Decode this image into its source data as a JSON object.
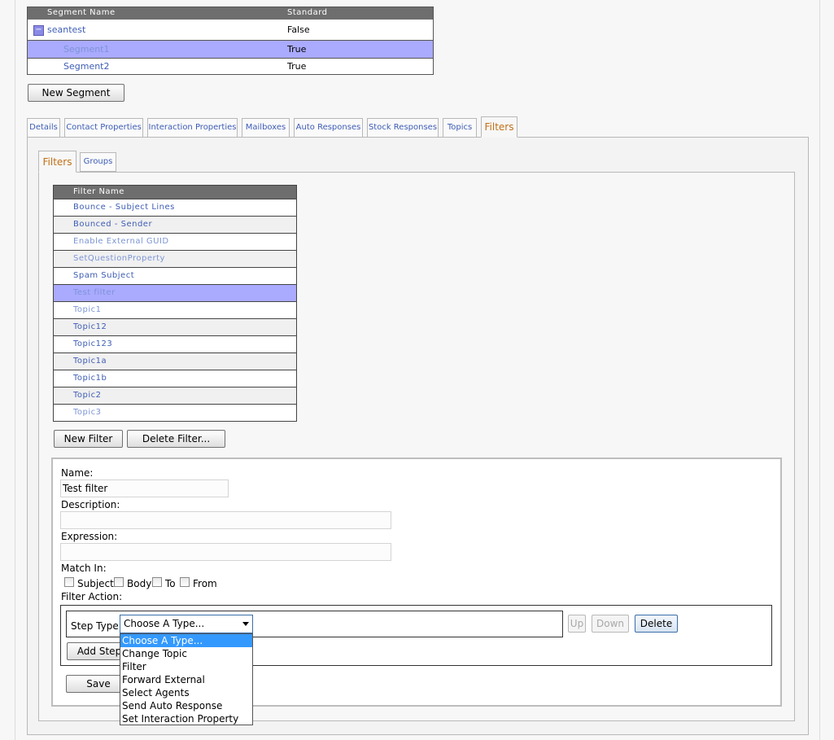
{
  "segments": {
    "columns": [
      "Segment Name",
      "Standard"
    ],
    "rows": [
      {
        "name": "seantest",
        "standard": "False",
        "expander": "collapse-icon",
        "expander_glyph": "−"
      },
      {
        "name": "Segment1",
        "standard": "True"
      },
      {
        "name": "Segment2",
        "standard": "True"
      }
    ]
  },
  "new_segment_label": "New Segment",
  "tabs": [
    "Details",
    "Contact Properties",
    "Interaction Properties",
    "Mailboxes",
    "Auto Responses",
    "Stock Responses",
    "Topics",
    "Filters"
  ],
  "active_tab": "Filters",
  "subtabs": [
    "Filters",
    "Groups"
  ],
  "active_subtab": "Filters",
  "filters": {
    "column": "Filter Name",
    "rows": [
      "Bounce - Subject Lines",
      "Bounced - Sender",
      "Enable External GUID",
      "SetQuestionProperty",
      "Spam Subject",
      "Test filter",
      "Topic1",
      "Topic12",
      "Topic123",
      "Topic1a",
      "Topic1b",
      "Topic2",
      "Topic3"
    ],
    "selected": "Test filter"
  },
  "buttons": {
    "new_filter": "New Filter",
    "delete_filter": "Delete Filter...",
    "up": "Up",
    "down": "Down",
    "delete": "Delete",
    "add_step": "Add Step",
    "save": "Save"
  },
  "form": {
    "name_label": "Name:",
    "name_value": "Test filter",
    "description_label": "Description:",
    "description_value": "",
    "expression_label": "Expression:",
    "expression_value": "",
    "match_in_label": "Match In:",
    "match_options": [
      {
        "label": "Subject",
        "checked": false
      },
      {
        "label": "Body",
        "checked": false
      },
      {
        "label": "To",
        "checked": false
      },
      {
        "label": "From",
        "checked": false
      }
    ],
    "filter_action_label": "Filter Action:",
    "step_type_label": "Step Type:",
    "step_type_value": "Choose A Type...",
    "step_type_options": [
      "Choose A Type...",
      "Change Topic",
      "Filter",
      "Forward External",
      "Select Agents",
      "Send Auto Response",
      "Set Interaction Property"
    ]
  },
  "colors": {
    "selected_row": "#aaaaff",
    "link": "#3e5db5",
    "active_tab_text": "#c07017",
    "header_bg": "#6e6e6e",
    "dropdown_highlight": "#3399ff"
  }
}
